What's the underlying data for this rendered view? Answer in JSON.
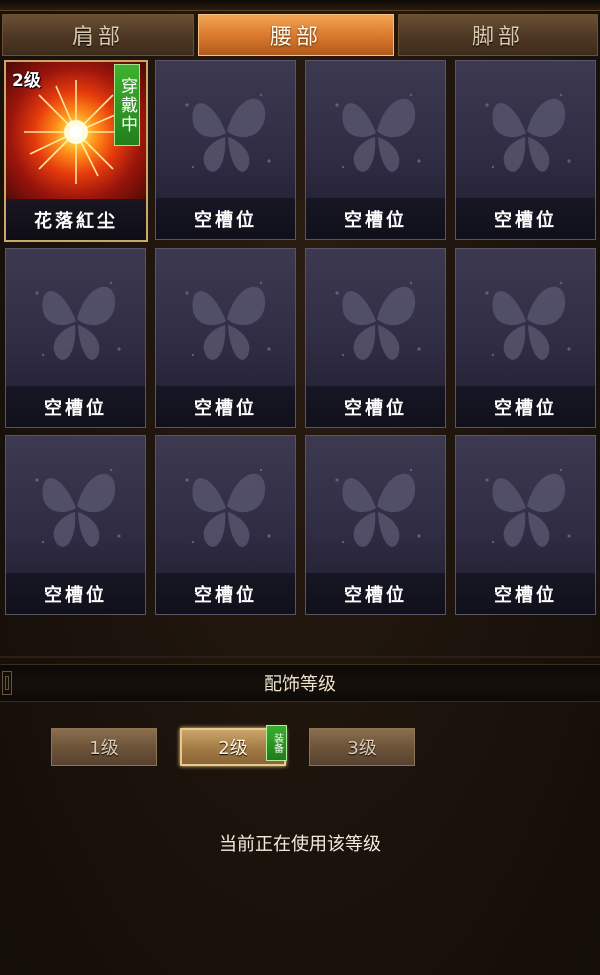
{
  "tabs": [
    {
      "label": "肩部",
      "active": false
    },
    {
      "label": "腰部",
      "active": true
    },
    {
      "label": "脚部",
      "active": false
    }
  ],
  "slots": [
    {
      "label": "花落紅尘",
      "level": "2级",
      "badge": "穿戴中",
      "equipped": true,
      "icon": "starburst-accessory-icon"
    },
    {
      "label": "空槽位",
      "icon": "butterfly-icon"
    },
    {
      "label": "空槽位",
      "icon": "butterfly-icon"
    },
    {
      "label": "空槽位",
      "icon": "butterfly-icon"
    },
    {
      "label": "空槽位",
      "icon": "butterfly-icon"
    },
    {
      "label": "空槽位",
      "icon": "butterfly-icon"
    },
    {
      "label": "空槽位",
      "icon": "butterfly-icon"
    },
    {
      "label": "空槽位",
      "icon": "butterfly-icon"
    },
    {
      "label": "空槽位",
      "icon": "butterfly-icon"
    },
    {
      "label": "空槽位",
      "icon": "butterfly-icon"
    },
    {
      "label": "空槽位",
      "icon": "butterfly-icon"
    },
    {
      "label": "空槽位",
      "icon": "butterfly-icon"
    }
  ],
  "level_section": {
    "title": "配饰等级",
    "buttons": [
      {
        "label": "1级",
        "active": false
      },
      {
        "label": "2级",
        "active": true
      },
      {
        "label": "3级",
        "active": false
      }
    ],
    "equip_tag": "装备",
    "status": "当前正在使用该等级"
  },
  "colors": {
    "tab_active": "#d8772c",
    "badge_green": "#2f9a25",
    "slot_bg": "#2f2c43"
  }
}
